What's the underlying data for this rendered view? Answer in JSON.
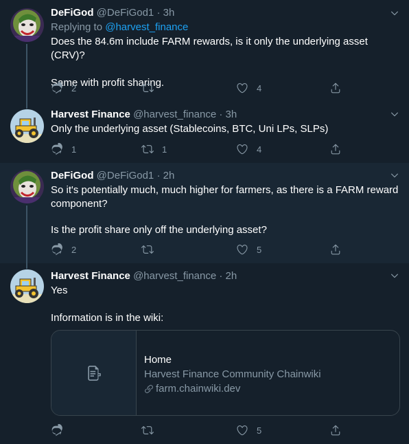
{
  "tweets": [
    {
      "name": "DeFiGod",
      "handle": "@DeFiGod1",
      "time": "· 3h",
      "reply_prefix": "Replying to",
      "reply_mention": "@harvest_finance",
      "text_line1": "Does the 84.6m include FARM rewards, is it only the underlying asset (CRV)?",
      "text_line2": "Same with profit sharing.",
      "replies": "2",
      "retweets": "",
      "likes": "4"
    },
    {
      "name": "Harvest Finance",
      "handle": "@harvest_finance",
      "time": "· 3h",
      "text_line1": "Only the underlying asset (Stablecoins, BTC, Uni LPs, SLPs)",
      "replies": "1",
      "retweets": "1",
      "likes": "4"
    },
    {
      "name": "DeFiGod",
      "handle": "@DeFiGod1",
      "time": "· 2h",
      "text_line1": "So it's potentially much, much higher for farmers, as there is a FARM reward",
      "text_line1b": "component?",
      "text_line2": "Is the profit share only off the underlying asset?",
      "replies": "2",
      "retweets": "",
      "likes": "5"
    },
    {
      "name": "Harvest Finance",
      "handle": "@harvest_finance",
      "time": "· 2h",
      "text_line1": "Yes",
      "text_line2": "Information is in the wiki:",
      "replies": "",
      "retweets": "",
      "likes": "5",
      "card": {
        "title": "Home",
        "description": "Harvest Finance Community Chainwiki",
        "domain": "farm.chainwiki.dev",
        "icon": "document-icon"
      }
    }
  ],
  "colors": {
    "background": "#15202b",
    "highlight": "#192734",
    "secondary_text": "#8899a6",
    "link": "#1da1f2",
    "border": "#38444d"
  }
}
